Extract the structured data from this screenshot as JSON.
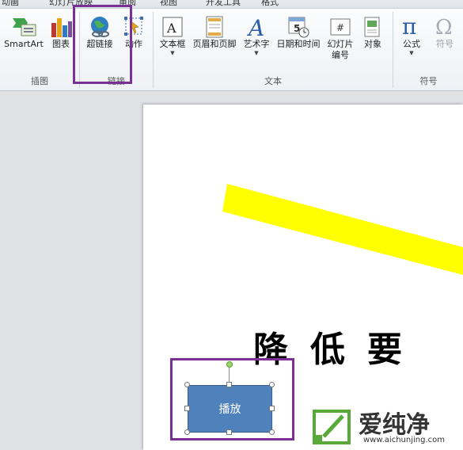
{
  "tabs": [
    "动画",
    "幻灯片放映",
    "审阅",
    "视图",
    "开发工具",
    "格式"
  ],
  "ribbon": {
    "groups": {
      "illustrations": {
        "label": "插图",
        "buttons": {
          "smartart": "SmartArt",
          "chart": "图表"
        }
      },
      "links": {
        "label": "链接",
        "buttons": {
          "hyperlink": "超链接",
          "action": "动作"
        }
      },
      "text": {
        "label": "文本",
        "buttons": {
          "textbox": "文本框",
          "header_footer": "页眉和页脚",
          "wordart": "艺术字",
          "datetime": "日期和时间",
          "slide_number_line1": "幻灯片",
          "slide_number_line2": "编号",
          "object": "对象"
        }
      },
      "symbols": {
        "label": "符号",
        "buttons": {
          "equation": "公式",
          "symbol": "符号"
        }
      }
    }
  },
  "slide": {
    "title_text": "降低要",
    "button_shape_text": "播放",
    "stripe_color": "#ffff00"
  },
  "watermark": {
    "brand": "爱纯净",
    "url": "www.aichunjing.com"
  },
  "colors": {
    "highlight": "#7a2f93",
    "shape_fill": "#4f81bd",
    "watermark_green": "#58a93a"
  }
}
